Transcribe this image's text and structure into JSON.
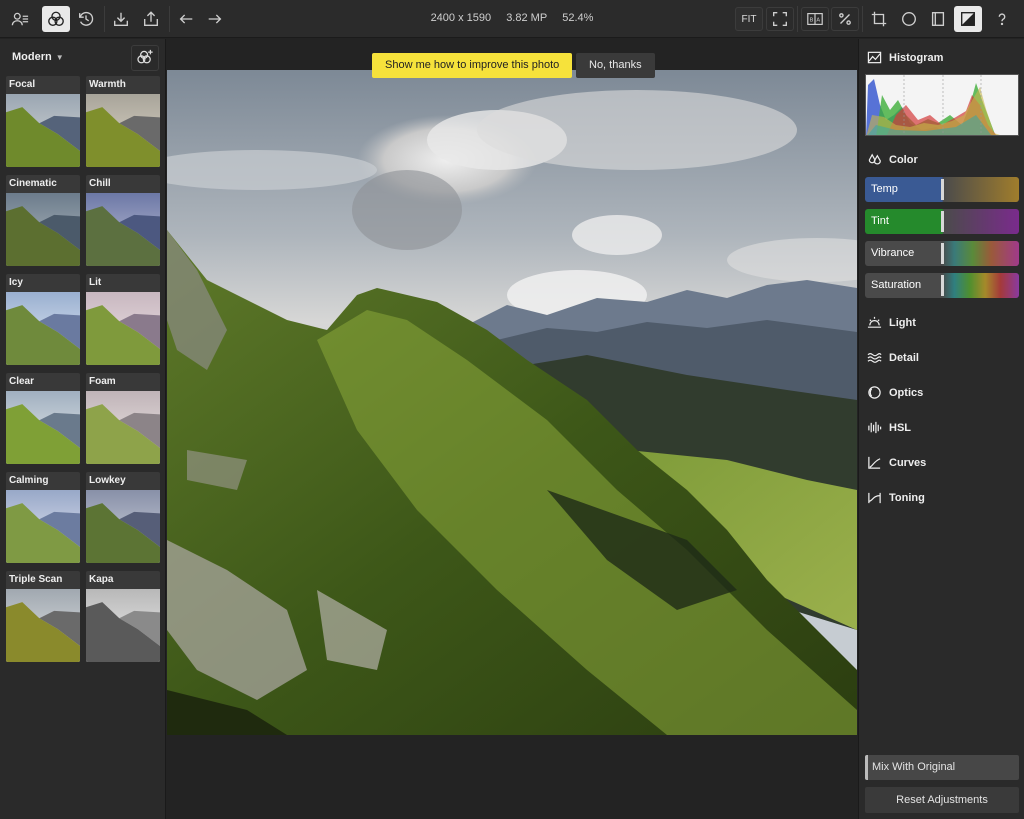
{
  "toolbar": {
    "dimensions": "2400 x 1590",
    "megapixels": "3.82 MP",
    "zoom": "52.4%",
    "fit_label": "FIT"
  },
  "presets": {
    "category": "Modern",
    "items": [
      {
        "label": "Focal",
        "tone": "normal"
      },
      {
        "label": "Warmth",
        "tone": "warm"
      },
      {
        "label": "Cinematic",
        "tone": "cinematic"
      },
      {
        "label": "Chill",
        "tone": "chill"
      },
      {
        "label": "Icy",
        "tone": "icy"
      },
      {
        "label": "Lit",
        "tone": "lit"
      },
      {
        "label": "Clear",
        "tone": "clear"
      },
      {
        "label": "Foam",
        "tone": "foam"
      },
      {
        "label": "Calming",
        "tone": "calming"
      },
      {
        "label": "Lowkey",
        "tone": "lowkey"
      },
      {
        "label": "Triple Scan",
        "tone": "triple"
      },
      {
        "label": "Kapa",
        "tone": "bw"
      }
    ]
  },
  "canvas": {
    "tip_text": "Show me how to improve this photo",
    "dismiss_text": "No, thanks"
  },
  "adjustments": {
    "histogram_label": "Histogram",
    "color_label": "Color",
    "sliders": [
      {
        "label": "Temp",
        "left": "#3a5fa0",
        "right": "#a07a2a"
      },
      {
        "label": "Tint",
        "left": "#2a8a30",
        "right": "#7a2a8a"
      },
      {
        "label": "Vibrance",
        "left": "#4a4a4a",
        "right": "rainbow"
      },
      {
        "label": "Saturation",
        "left": "#4a4a4a",
        "right": "rainbow"
      }
    ],
    "sections": [
      "Light",
      "Detail",
      "Optics",
      "HSL",
      "Curves",
      "Toning"
    ],
    "mix_label": "Mix With Original",
    "reset_label": "Reset Adjustments"
  }
}
